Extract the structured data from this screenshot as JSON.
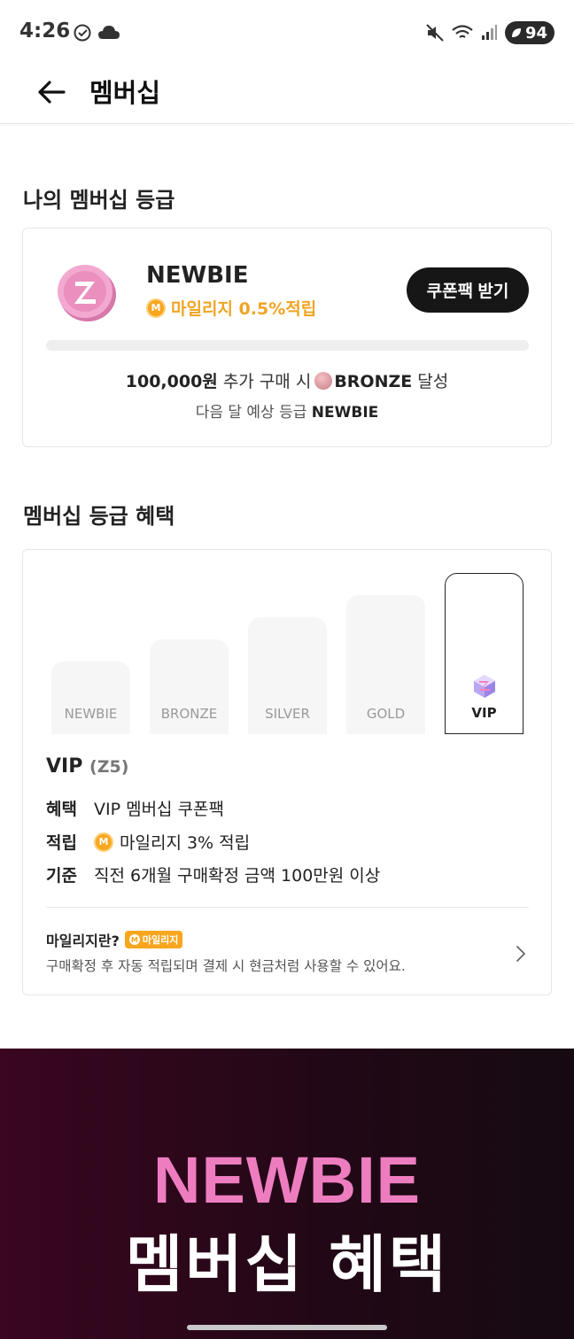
{
  "status_bar": {
    "time": "4:26",
    "battery": "94"
  },
  "header": {
    "title": "멤버십"
  },
  "my_grade": {
    "section_title": "나의 멤버십 등급",
    "grade": "NEWBIE",
    "mileage_rate": "마일리지 0.5%적립",
    "coupon_button": "쿠폰팩 받기",
    "progress_fraction": 0.0,
    "progress_amount": "100,000원",
    "progress_text": "추가 구매 시",
    "progress_target": "BRONZE",
    "progress_suffix": "달성",
    "next_month_label": "다음 달 예상 등급",
    "next_month_grade": "NEWBIE"
  },
  "benefits": {
    "section_title": "멤버십 등급 혜택",
    "tiers": [
      "NEWBIE",
      "BRONZE",
      "SILVER",
      "GOLD",
      "VIP"
    ],
    "selected_tier": "VIP",
    "selected_code": "(Z5)",
    "rows": [
      {
        "key": "혜택",
        "value": "VIP 멤버십 쿠폰팩"
      },
      {
        "key": "적립",
        "value": "마일리지 3% 적립"
      },
      {
        "key": "기준",
        "value": "직전 6개월 구매확정 금액 100만원 이상"
      }
    ],
    "mileage_question": "마일리지란?",
    "mileage_badge": "마일리지",
    "mileage_desc": "구매확정 후 자동 적립되며 결제 시 현금처럼 사용할 수 있어요."
  },
  "banner": {
    "grade": "NEWBIE",
    "subtitle": "멤버십 혜택"
  },
  "colors": {
    "accent_orange": "#f7a61e",
    "banner_pink": "#ee7dc0",
    "dark_button": "#161616"
  },
  "icons": {
    "status_left": [
      "check-circle-icon",
      "cloud-icon"
    ],
    "status_right": [
      "mute-icon",
      "wifi-icon",
      "signal-icon",
      "battery-icon"
    ],
    "back": "arrow-left-icon",
    "chevron": "chevron-right-icon"
  }
}
